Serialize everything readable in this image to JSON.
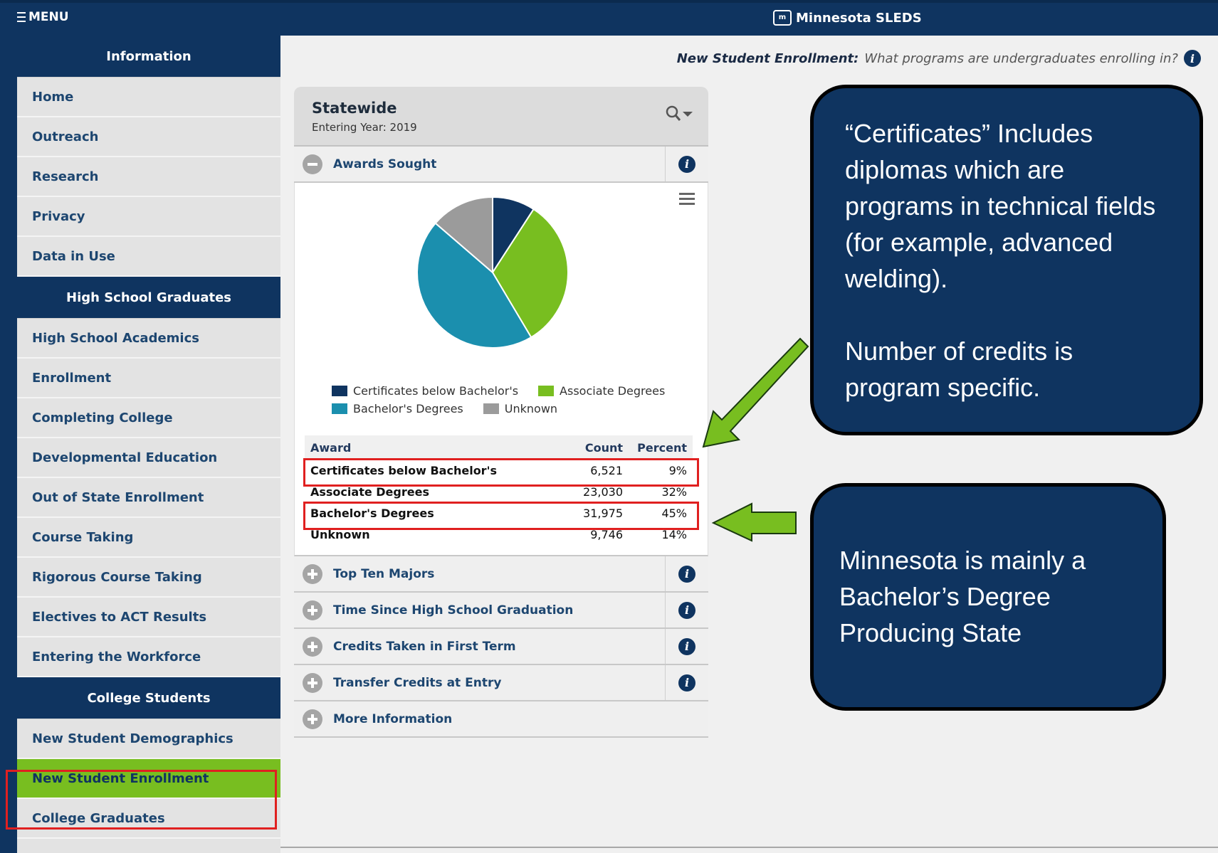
{
  "header": {
    "menu_label": "MENU",
    "brand_logo": "m",
    "brand_name": "Minnesota SLEDS"
  },
  "sidebar": {
    "sections": [
      {
        "title": "Information",
        "items": [
          "Home",
          "Outreach",
          "Research",
          "Privacy",
          "Data in Use"
        ]
      },
      {
        "title": "High School Graduates",
        "items": [
          "High School Academics",
          "Enrollment",
          "Completing College",
          "Developmental Education",
          "Out of State Enrollment",
          "Course Taking",
          "Rigorous Course Taking",
          "Electives to ACT Results",
          "Entering the Workforce"
        ]
      },
      {
        "title": "College Students",
        "items": [
          "New Student Demographics",
          "New Student Enrollment",
          "College Graduates"
        ]
      }
    ],
    "active_item": "New Student Enrollment"
  },
  "page": {
    "question_label": "New Student Enrollment:",
    "question_text": "What programs are undergraduates enrolling in?"
  },
  "panel": {
    "title": "Statewide",
    "subtitle": "Entering Year: 2019",
    "search_icon": "magnifier-icon",
    "sections": [
      "Awards Sought",
      "Top Ten Majors",
      "Time Since High School Graduation",
      "Credits Taken in First Term",
      "Transfer Credits at Entry",
      "More Information"
    ]
  },
  "chart_data": {
    "type": "pie",
    "labels": [
      "Certificates below Bachelor's",
      "Associate Degrees",
      "Bachelor's Degrees",
      "Unknown"
    ],
    "values": [
      6521,
      23030,
      31975,
      9746
    ],
    "percents": [
      "9%",
      "32%",
      "45%",
      "14%"
    ],
    "colors": [
      "#0f3460",
      "#78be20",
      "#1b8fae",
      "#9b9b9b"
    ],
    "legend_position": "bottom"
  },
  "table": {
    "headers": [
      "Award",
      "Count",
      "Percent"
    ],
    "rows": [
      [
        "Certificates below Bachelor's",
        "6,521",
        "9%"
      ],
      [
        "Associate Degrees",
        "23,030",
        "32%"
      ],
      [
        "Bachelor's Degrees",
        "31,975",
        "45%"
      ],
      [
        "Unknown",
        "9,746",
        "14%"
      ]
    ]
  },
  "callouts": {
    "certificates": [
      "“Certificates” Includes diplomas which are programs in technical fields (for example, advanced welding).",
      "Number of credits is program specific."
    ],
    "bachelors": "Minnesota is mainly a Bachelor’s Degree Producing State"
  },
  "colors": {
    "navy": "#0f3460",
    "green": "#78be20",
    "teal": "#1b8fae",
    "gray": "#9b9b9b",
    "highlight_red": "#e02020"
  }
}
